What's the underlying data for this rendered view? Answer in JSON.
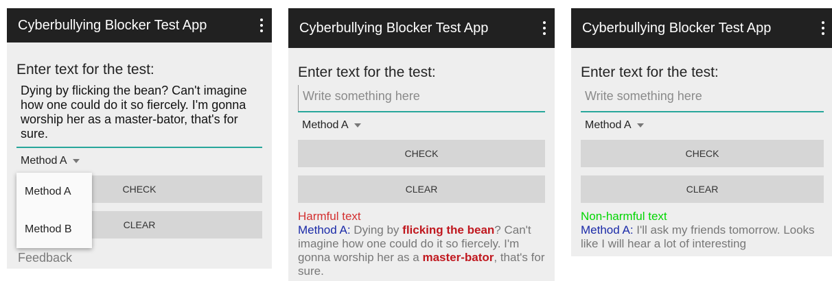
{
  "app": {
    "title": "Cyberbullying Blocker Test App"
  },
  "screens": [
    {
      "prompt": "Enter text for the test:",
      "input_text": "Dying by flicking the bean? Can't imagine how one could do it so fiercely. I'm gonna worship her as a master-bator, that's for sure.",
      "method_selected": "Method A",
      "buttons": {
        "check": "CHECK",
        "clear": "CLEAR"
      },
      "dropdown_options": [
        "Method A",
        "Method B"
      ],
      "feedback": "Feedback"
    },
    {
      "prompt": "Enter text for the test:",
      "placeholder": "Write something here",
      "method_selected": "Method A",
      "buttons": {
        "check": "CHECK",
        "clear": "CLEAR"
      },
      "result": {
        "status": "Harmful text",
        "method_label": "Method A:",
        "segments": [
          {
            "text": " Dying by ",
            "flag": false
          },
          {
            "text": "flicking the bean",
            "flag": true
          },
          {
            "text": "? Can't imagine how one could do it so fiercely. I'm gonna worship her as a ",
            "flag": false
          },
          {
            "text": "master-bator",
            "flag": true
          },
          {
            "text": ", that's for sure.",
            "flag": false
          }
        ]
      }
    },
    {
      "prompt": "Enter text for the test:",
      "placeholder": "Write something here",
      "method_selected": "Method A",
      "buttons": {
        "check": "CHECK",
        "clear": "CLEAR"
      },
      "result": {
        "status": "Non-harmful text",
        "method_label": "Method A:",
        "text": " I'll ask my friends tomorrow. Looks like I will hear a lot of interesting"
      }
    }
  ],
  "colors": {
    "appbar": "#212121",
    "accent_underline": "#26a69a",
    "harmful": "#d32f2f",
    "non_harmful": "#00d600",
    "method_label": "#1a2aa8",
    "flagged_words": "#c0181f"
  },
  "icons": {
    "overflow_menu": "more-vert-icon",
    "dropdown": "caret-down-icon"
  }
}
